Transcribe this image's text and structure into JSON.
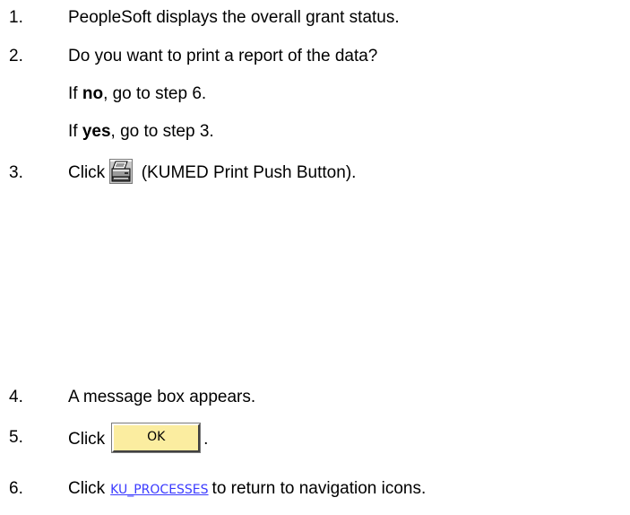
{
  "steps": [
    {
      "num": "1.",
      "text": "PeopleSoft displays the overall grant status."
    },
    {
      "num": "2.",
      "text": "Do you want to print a report of the data?"
    },
    {
      "num": "3.",
      "before": "Click",
      "after": "(KUMED Print Push Button)."
    },
    {
      "num": "4.",
      "text": "A message box appears."
    },
    {
      "num": "5.",
      "before": "Click",
      "button_label": "OK",
      "after": "."
    },
    {
      "num": "6.",
      "before": "Click",
      "link_label": "KU_PROCESSES",
      "after": "to return to navigation icons."
    }
  ],
  "step2_options": [
    {
      "prefix": "If ",
      "keyword": "no",
      "suffix": ", go to step 6."
    },
    {
      "prefix": "If ",
      "keyword": "yes",
      "suffix": ", go to step 3."
    }
  ],
  "icons": {
    "print": "printer-icon"
  },
  "colors": {
    "button_bg": "#fbeda0",
    "link": "#3a3aff"
  }
}
